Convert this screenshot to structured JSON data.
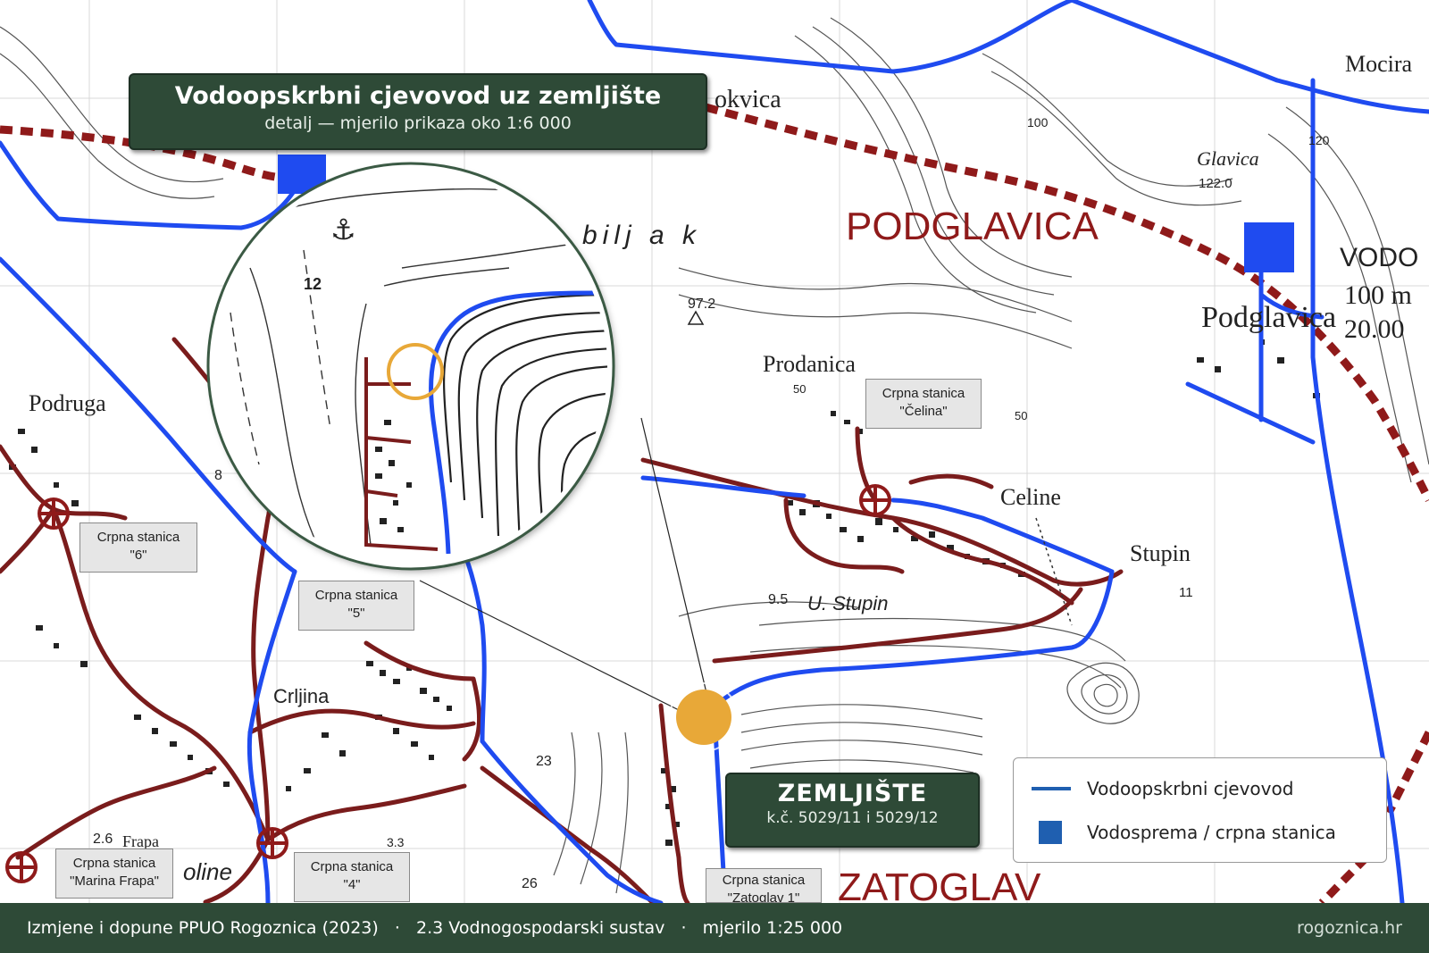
{
  "title": {
    "main": "Vodoopskrbni cjevovod uz zemljište",
    "sub": "detalj — mjerilo prikaza oko 1:6 000"
  },
  "plot": {
    "title": "ZEMLJIŠTE",
    "parcels": "k.č. 5029/11 i 5029/12"
  },
  "legend": {
    "pipeline": "Vodoopskrbni cjevovod",
    "reservoir": "Vodosprema / crpna stanica",
    "pipeline_color": "#1f5fb0"
  },
  "footer": {
    "left": "Izmjene i dopune PPUO Rogoznica (2023)   ·   2.3 Vodnogospodarski sustav   ·   mjerilo 1:25 000",
    "right": "rogoznica.hr"
  },
  "pump_stations": {
    "celina": [
      "Crpna stanica",
      "\"Čelina\""
    ],
    "six": [
      "Crpna stanica",
      "\"6\""
    ],
    "five": [
      "Crpna stanica",
      "\"5\""
    ],
    "marina": [
      "Crpna stanica",
      "\"Marina Frapa\""
    ],
    "four": [
      "Crpna stanica",
      "\"4\""
    ],
    "zatoglav": [
      "Crpna stanica",
      "\"Zatoglav 1\""
    ]
  },
  "place_names": {
    "podglavica_zone": "PODGLAVICA",
    "zatoglav_zone": "ZATOGLAV",
    "mocira": "Mocira",
    "glavica": "Glavica",
    "podglavica": "Podglavica",
    "prodanica": "Prodanica",
    "celine": "Celine",
    "stupin": "Stupin",
    "u_stupin": "U. Stupin",
    "podruga": "Podruga",
    "crljina": "Crljina",
    "biljak": "bilj a k",
    "okvica": "okvica",
    "frapa": "Frapa",
    "oline": "oline",
    "vodo": "VODO",
    "vodo_cap": "100 m",
    "vodo_vol": "20.00"
  },
  "elevations": {
    "e122": "122.0",
    "e97": "97.2",
    "e120": "120",
    "e100": "100",
    "e50a": "50",
    "e50b": "50",
    "e9_5": "9.5",
    "e11": "11",
    "e23": "23",
    "e26": "26",
    "e2_6": "2.6",
    "e3_3": "3.3",
    "e12": "12",
    "e8": "8"
  },
  "colors": {
    "pipeline": "#1f4bf0",
    "boundary": "#8f1a1a",
    "sewer": "#7a1c1c",
    "plot_marker": "#e8a838",
    "panel": "#2e4a37"
  }
}
